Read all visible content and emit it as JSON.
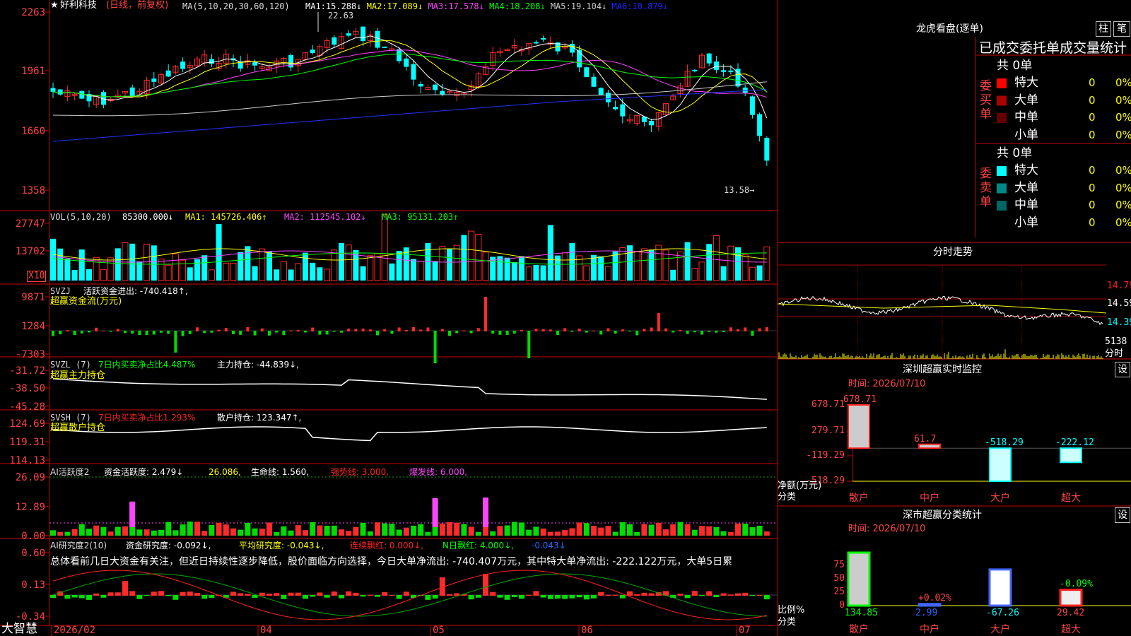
{
  "header": {
    "title": "好利科技",
    "mode": "(日线，前复权)",
    "ma_label": "MA(5,10,20,30,60,120)",
    "ma": [
      {
        "label": "MA1:",
        "value": "15.288↓",
        "color": "#ffffff"
      },
      {
        "label": "MA2:",
        "value": "17.089↓",
        "color": "#ffff00"
      },
      {
        "label": "MA3:",
        "value": "17.578↓",
        "color": "#ff44ff"
      },
      {
        "label": "MA4:",
        "value": "18.208↓",
        "color": "#00ff00"
      },
      {
        "label": "MA5:",
        "value": "19.104↓",
        "color": "#cccccc"
      },
      {
        "label": "MA6:",
        "value": "18.879↓",
        "color": "#2222ff"
      }
    ]
  },
  "price_pane": {
    "yticks": [
      "2263",
      "1961",
      "1660",
      "1358"
    ],
    "high_label": "22.63",
    "low_label": "13.58→"
  },
  "vol_pane": {
    "label": "VOL(5,10,20)",
    "value": "85300.000↓",
    "ma1": "MA1: 145726.406↑",
    "ma2": "MA2: 112545.102↓",
    "ma3": "MA3: 95131.203↑",
    "yticks": [
      "27747",
      "13702"
    ],
    "unit": "X10"
  },
  "svzj_pane": {
    "label": "SVZJ",
    "text": "活跃资金进出: -740.418↑,",
    "name": "超赢资金流(万元)",
    "yticks": [
      "9871",
      "1284",
      "-7303"
    ]
  },
  "svzl_pane": {
    "label": "SVZL (7)",
    "text1": "7日内买卖净占比4.487%",
    "text2": "主力持仓: -44.839↓,",
    "name": "超赢主力持仓",
    "yticks": [
      "-31.72",
      "-38.50",
      "-45.28"
    ]
  },
  "svsh_pane": {
    "label": "SVSH (7)",
    "text1": "7日内买卖净占比1.293%",
    "text2": "散户持仓: 123.347↑,",
    "name": "超赢散户持仓",
    "yticks": [
      "124.69",
      "119.31",
      "114.13"
    ]
  },
  "ai1_pane": {
    "label": "AI活跃度2",
    "t1": "资金活跃度: 2.479↓",
    "t2": "26.086,",
    "t3": "生命线: 1.560,",
    "t4": "强势线: 3.000,",
    "t5": "爆发线: 6.000,",
    "yticks": [
      "26.09",
      "12.89",
      "0.00"
    ]
  },
  "ai2_pane": {
    "label": "AI研究度2(10)",
    "t1": "资金研究度: -0.092↓,",
    "t2": "平均研究度: -0.043↓,",
    "t3": "连续飘红: 0.000↓,",
    "t4": "N日飘红: 4.000↓,",
    "t5": "-0.043↓",
    "summary": "总体看前几日大资金有关注，但近日持续性逐步降低，股价面临方向选择，今日大单净流出: -740.407万元，其中特大单净流出: -222.122万元，大单5日累",
    "yticks": [
      "0.60",
      "0.13",
      "-0.34"
    ]
  },
  "footer": {
    "brand": "大智慧",
    "dates": [
      "2026/02",
      "04",
      "05",
      "06",
      "07"
    ]
  },
  "right": {
    "lhb_title": "龙虎看盘(逐单)",
    "btn_bar": "柱",
    "btn_pen": "笔",
    "order_header": "已成交委托单成交量统计",
    "buy_label": "委买单",
    "sell_label": "委卖单",
    "buy_total": "共 0单",
    "sell_total": "共 0单",
    "buy_rows": [
      {
        "name": "特大",
        "vol": "0",
        "pct": "0%",
        "color": "#ff0000"
      },
      {
        "name": "大单",
        "vol": "0",
        "pct": "0%",
        "color": "#aa0000"
      },
      {
        "name": "中单",
        "vol": "0",
        "pct": "0%",
        "color": "#660000"
      },
      {
        "name": "小单",
        "vol": "0",
        "pct": "0%",
        "color": ""
      }
    ],
    "sell_rows": [
      {
        "name": "特大",
        "vol": "0",
        "pct": "0%",
        "color": "#00ffff"
      },
      {
        "name": "大单",
        "vol": "0",
        "pct": "0%",
        "color": "#008888"
      },
      {
        "name": "中单",
        "vol": "0",
        "pct": "0%",
        "color": "#006666"
      },
      {
        "name": "小单",
        "vol": "0",
        "pct": "0%",
        "color": ""
      }
    ],
    "intraday_title": "分时走势",
    "intraday_yticks": [
      "14.79",
      "14.59",
      "14.39"
    ],
    "intraday_vol": "5138",
    "intraday_vol_unit": "分时",
    "monitor_title": "深圳超赢实时监控",
    "set_label": "设",
    "monitor_time": "时间: 2026/07/10",
    "monitor_yticks": [
      "678.71",
      "279.71",
      "-119.29",
      "-518.29"
    ],
    "monitor_ylabel": "净额(万元)",
    "monitor_xlabel": "分类",
    "classify_title": "深市超赢分类统计",
    "classify_time": "时间: 2026/07/10",
    "classify_yticks": [
      "75",
      "50",
      "25",
      "0"
    ],
    "classify_ylabel": "比例%",
    "classify_xlabel": "分类",
    "categories": [
      "散户",
      "中户",
      "大户",
      "超大"
    ]
  },
  "chart_data": [
    {
      "type": "bar",
      "title": "深圳超赢实时监控",
      "categories": [
        "散户",
        "中户",
        "大户",
        "超大"
      ],
      "values": [
        678.71,
        61.7,
        -518.29,
        -222.12
      ],
      "ylabel": "净额(万元)",
      "ylim": [
        -518.29,
        678.71
      ]
    },
    {
      "type": "bar",
      "title": "深市超赢分类统计",
      "categories": [
        "散户",
        "中户",
        "大户",
        "超大"
      ],
      "values": [
        134.85,
        2.99,
        -67.26,
        29.42
      ],
      "labels_pct": [
        "",
        "+0.02%",
        "",
        "-0.09%"
      ],
      "ylabel": "比例%",
      "ylim": [
        0,
        75
      ]
    }
  ]
}
